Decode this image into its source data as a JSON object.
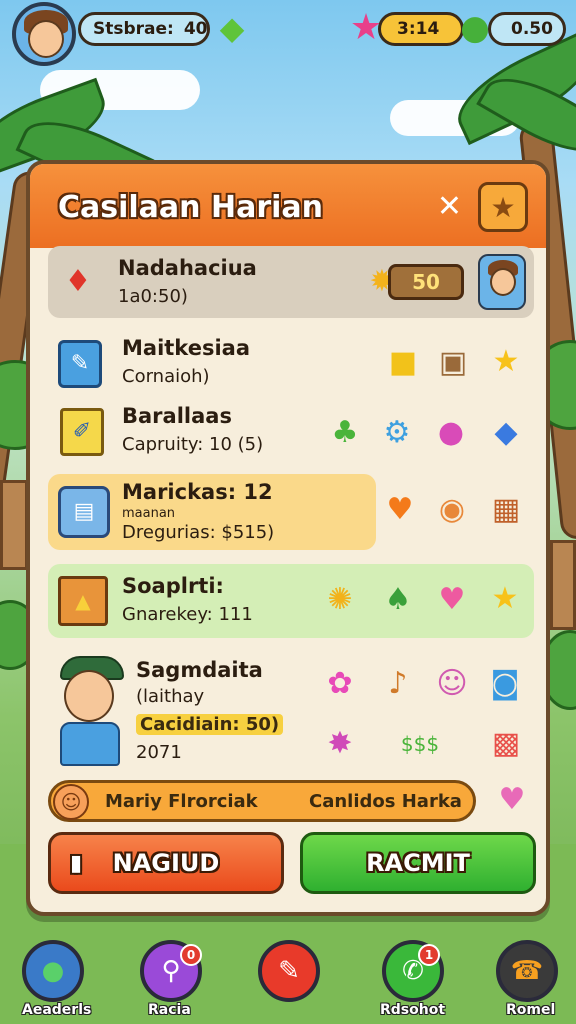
{
  "hud": {
    "level_label": "Stsbrae:",
    "level_value": "40",
    "timer_label": "3:14",
    "coins_value": "0.50"
  },
  "panel": {
    "title": "Casilaan Harian",
    "close_glyph": "✕",
    "star_glyph": "★"
  },
  "rows": [
    {
      "name": "Nadahaciua",
      "sub": "1a0:50)",
      "reward": "50"
    },
    {
      "name": "Maitkesiaa",
      "sub": "Cornaioh)"
    },
    {
      "name": "Barallaas",
      "sub": "Capruity: 10 (5)"
    },
    {
      "name": "Marickas: 12",
      "sub_small": "maanan",
      "sub": "Dregurias: $515)"
    },
    {
      "name": "Soaplrti:",
      "sub": "Gnarekey: 111"
    },
    {
      "name": "Sagmdaita",
      "sub": "(laithay",
      "sub2": "Cacidiain: 50)",
      "sub3": "2071"
    }
  ],
  "banner": {
    "left": "Mariy Flrorciak",
    "right": "Canlidos Harka"
  },
  "buttons": {
    "left": "NAGIUD",
    "right": "RACMIT"
  },
  "bottom_nav": [
    {
      "label": "Aeaderls",
      "badge": ""
    },
    {
      "label": "Racia",
      "badge": "0"
    },
    {
      "label": "",
      "badge": ""
    },
    {
      "label": "Rdsohot",
      "badge": "1"
    },
    {
      "label": "Romel",
      "badge": ""
    }
  ],
  "colors": {
    "accent": "#ec6f22",
    "confirm": "#3fbf3a",
    "cancel": "#ef5a26"
  }
}
